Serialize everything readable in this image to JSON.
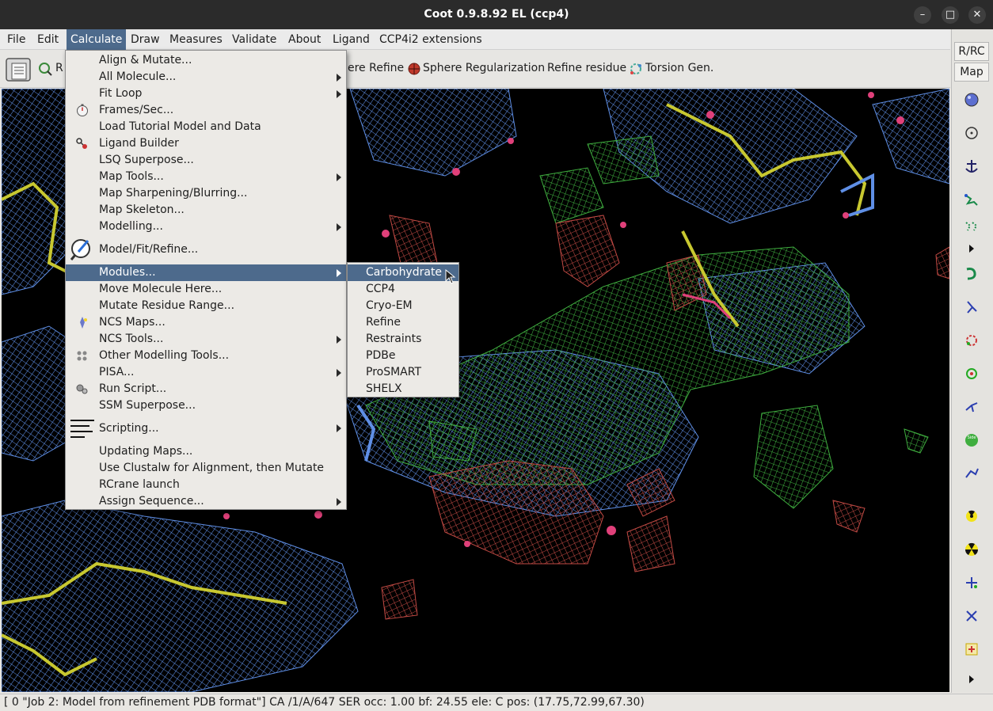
{
  "window": {
    "title": "Coot 0.9.8.92 EL (ccp4)",
    "controls": [
      "–",
      "□",
      "✕"
    ]
  },
  "menubar": {
    "items": [
      "File",
      "Edit",
      "Calculate",
      "Draw",
      "Measures",
      "Validate",
      "About",
      "Ligand",
      "CCP4i2 extensions"
    ],
    "active": "Calculate"
  },
  "toolbar": {
    "partial_left": "R",
    "sphere_refine_partial": "ere Refine",
    "sphere_regularization": "Sphere Regularization",
    "refine_residue": "Refine residue",
    "torsion_gen": "Torsion Gen."
  },
  "side_panel": {
    "tab_rrc": "R/RC",
    "tab_map": "Map",
    "icons": [
      "globe-icon",
      "crosshair-icon",
      "anchor-icon",
      "rotate-translate-icon",
      "rotamer-icon",
      "expand-arrow-icon",
      "auto-fit-rotamer-icon",
      "flip-peptide-icon",
      "pepflip-icon",
      "chiral-icon",
      "sidechain-180-icon",
      "side-chain-icon",
      "edit-chi-icon",
      "radioactive-small-icon",
      "radioactive-icon",
      "add-atom-icon",
      "delete-atom-icon",
      "add-alt-conf-icon",
      "scroll-down-icon"
    ]
  },
  "calculate_menu": {
    "items": [
      {
        "label": "Align & Mutate...",
        "submenu": false,
        "icon": ""
      },
      {
        "label": "All Molecule...",
        "submenu": true,
        "icon": ""
      },
      {
        "label": "Fit Loop",
        "submenu": true,
        "icon": ""
      },
      {
        "label": "Frames/Sec...",
        "submenu": false,
        "icon": "stopwatch-icon"
      },
      {
        "label": "Load Tutorial Model and Data",
        "submenu": false,
        "icon": ""
      },
      {
        "label": "Ligand Builder",
        "submenu": false,
        "icon": "ligand-icon"
      },
      {
        "label": "LSQ Superpose...",
        "submenu": false,
        "icon": ""
      },
      {
        "label": "Map Tools...",
        "submenu": true,
        "icon": ""
      },
      {
        "label": "Map Sharpening/Blurring...",
        "submenu": false,
        "icon": ""
      },
      {
        "label": "Map Skeleton...",
        "submenu": false,
        "icon": ""
      },
      {
        "label": "Modelling...",
        "submenu": true,
        "icon": ""
      },
      {
        "label": "Model/Fit/Refine...",
        "submenu": false,
        "icon": "magnifier-pen-icon"
      },
      {
        "label": "Modules...",
        "submenu": true,
        "icon": ""
      },
      {
        "label": "Move Molecule Here...",
        "submenu": false,
        "icon": ""
      },
      {
        "label": "Mutate Residue Range...",
        "submenu": false,
        "icon": ""
      },
      {
        "label": "NCS Maps...",
        "submenu": false,
        "icon": "ncs-icon"
      },
      {
        "label": "NCS Tools...",
        "submenu": true,
        "icon": ""
      },
      {
        "label": "Other Modelling Tools...",
        "submenu": false,
        "icon": "modelling-tools-icon"
      },
      {
        "label": "PISA...",
        "submenu": true,
        "icon": ""
      },
      {
        "label": "Run Script...",
        "submenu": false,
        "icon": "gears-icon"
      },
      {
        "label": "SSM Superpose...",
        "submenu": false,
        "icon": ""
      },
      {
        "label": "Scripting...",
        "submenu": true,
        "icon": "text-lines-icon"
      },
      {
        "label": "Updating Maps...",
        "submenu": false,
        "icon": ""
      },
      {
        "label": "Use Clustalw for Alignment, then Mutate",
        "submenu": false,
        "icon": ""
      },
      {
        "label": "RCrane launch",
        "submenu": false,
        "icon": ""
      },
      {
        "label": "Assign Sequence...",
        "submenu": true,
        "icon": ""
      }
    ],
    "highlighted": "Modules..."
  },
  "modules_submenu": {
    "items": [
      "Carbohydrate",
      "CCP4",
      "Cryo-EM",
      "Refine",
      "Restraints",
      "PDBe",
      "ProSMART",
      "SHELX"
    ],
    "highlighted": "Carbohydrate"
  },
  "statusbar": {
    "text": "[ 0 \"Job 2: Model from refinement PDB format\"]  CA /1/A/647 SER occ: 1.00 bf: 24.55 ele:  C pos: (17.75,72.99,67.30)"
  },
  "colors": {
    "menu_highlight": "#4d6a8c",
    "density_blue": "#5f8fe6",
    "density_green": "#3fae3f",
    "density_red": "#c24a44",
    "bonds_yellow": "#c8c830",
    "atoms_pink": "#e0407a"
  }
}
